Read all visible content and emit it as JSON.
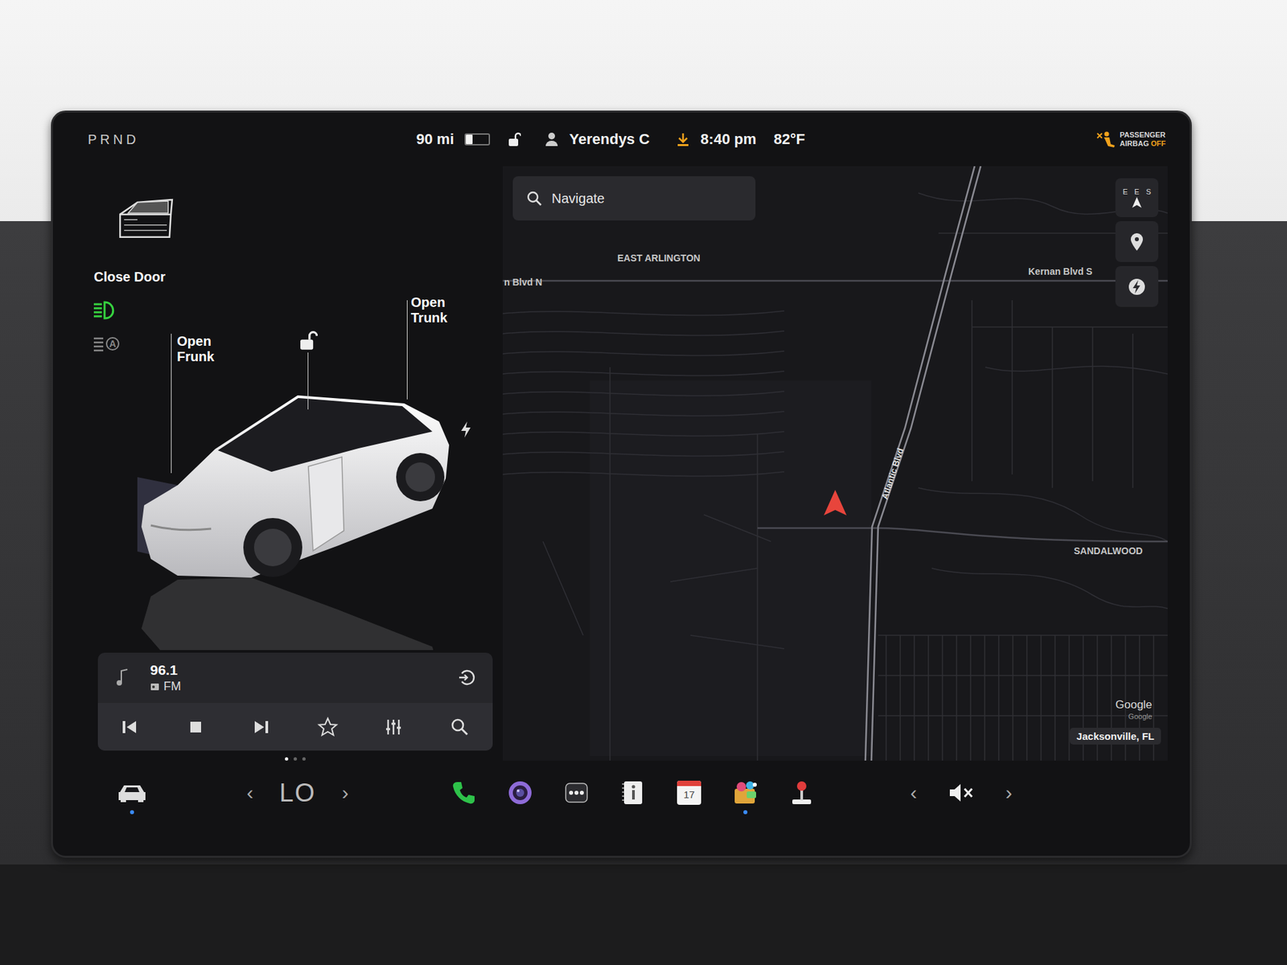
{
  "status_bar": {
    "gear": "PRND",
    "range": "90 mi",
    "battery_level": 0.3,
    "locked": false,
    "driver": "Yerendys C",
    "update_available": true,
    "time": "8:40 pm",
    "temperature": "82°F",
    "airbag": {
      "line1": "PASSENGER",
      "line2": "AIRBAG",
      "state": "OFF"
    }
  },
  "car_panel": {
    "door_label": "Close Door",
    "door_open": true,
    "headlights_on": true,
    "auto_high_beam_on": false,
    "auto_high_beam_glyph": "A",
    "frunk_label": "Open Frunk",
    "trunk_label": "Open Trunk",
    "locked": false,
    "charge_port": true
  },
  "media": {
    "station": "96.1",
    "band": "FM",
    "playing": true,
    "favorite": false,
    "pages": [
      {
        "selected": true
      },
      {
        "selected": false
      },
      {
        "selected": false
      }
    ]
  },
  "map": {
    "search_placeholder": "Navigate",
    "compass": [
      "E",
      "E",
      "S"
    ],
    "labels": [
      "EAST ARLINGTON",
      "n Blvd N",
      "Kernan Blvd S",
      "Atlantic Blvd",
      "SANDALWOOD"
    ],
    "attribution": "Google",
    "attribution_small": "Google",
    "location": "Jacksonville, FL"
  },
  "dock": {
    "car_badge": true,
    "climate": {
      "left_arrow": "‹",
      "temperature": "LO",
      "right_arrow": "›"
    },
    "apps": [
      {
        "kind": "phone",
        "badge": false
      },
      {
        "kind": "camera",
        "badge": false
      },
      {
        "kind": "more",
        "badge": false
      },
      {
        "kind": "manual",
        "badge": false
      },
      {
        "kind": "calendar",
        "label": "17",
        "badge": false
      },
      {
        "kind": "toybox",
        "badge": true
      },
      {
        "kind": "joystick",
        "badge": false
      }
    ],
    "volume": {
      "left_arrow": "‹",
      "muted": true,
      "right_arrow": "›"
    }
  }
}
